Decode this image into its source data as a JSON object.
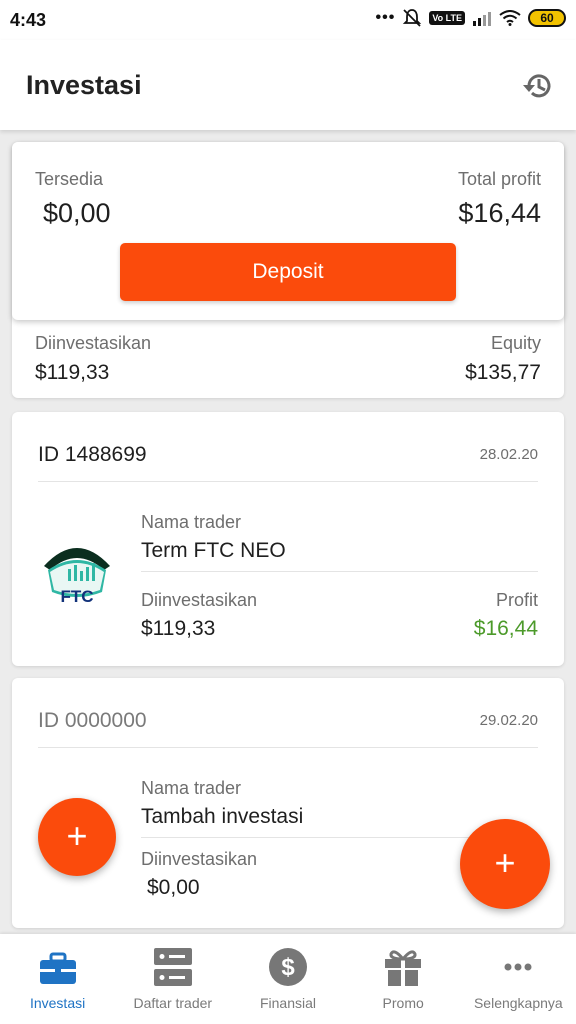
{
  "status_bar": {
    "time": "4:43",
    "dots": "•••",
    "volte": "Vo LTE",
    "battery": "60"
  },
  "app_bar": {
    "title": "Investasi",
    "history_icon": "history-icon"
  },
  "summary": {
    "available_label": "Tersedia",
    "available_value": "$0,00",
    "total_profit_label": "Total profit",
    "total_profit_value": "$16,44",
    "deposit_label": "Deposit",
    "invested_label": "Diinvestasikan",
    "invested_value": "$119,33",
    "equity_label": "Equity",
    "equity_value": "$135,77"
  },
  "investments": [
    {
      "id": "ID 1488699",
      "date": "28.02.20",
      "trader_label": "Nama trader",
      "trader_name": "Term FTC NEO",
      "invested_label": "Diinvestasikan",
      "invested_value": "$119,33",
      "profit_label": "Profit",
      "profit_value": "$16,44",
      "logo_text": "FTC"
    },
    {
      "id": "ID 0000000",
      "date": "29.02.20",
      "trader_label": "Nama trader",
      "trader_name": "Tambah investasi",
      "invested_label": "Diinvestasikan",
      "invested_value": "$0,00"
    }
  ],
  "fab": {
    "symbol": "+"
  },
  "bottom_nav": [
    {
      "label": "Investasi",
      "icon": "briefcase-icon",
      "active": true
    },
    {
      "label": "Daftar trader",
      "icon": "server-list-icon",
      "active": false
    },
    {
      "label": "Finansial",
      "icon": "dollar-icon",
      "active": false
    },
    {
      "label": "Promo",
      "icon": "gift-icon",
      "active": false
    },
    {
      "label": "Selengkapnya",
      "icon": "more-icon",
      "active": false
    }
  ],
  "colors": {
    "accent": "#fb4b0c",
    "active_nav": "#1f73c4",
    "profit_green": "#4c9a2a",
    "inactive_nav": "#7a7a7a"
  }
}
